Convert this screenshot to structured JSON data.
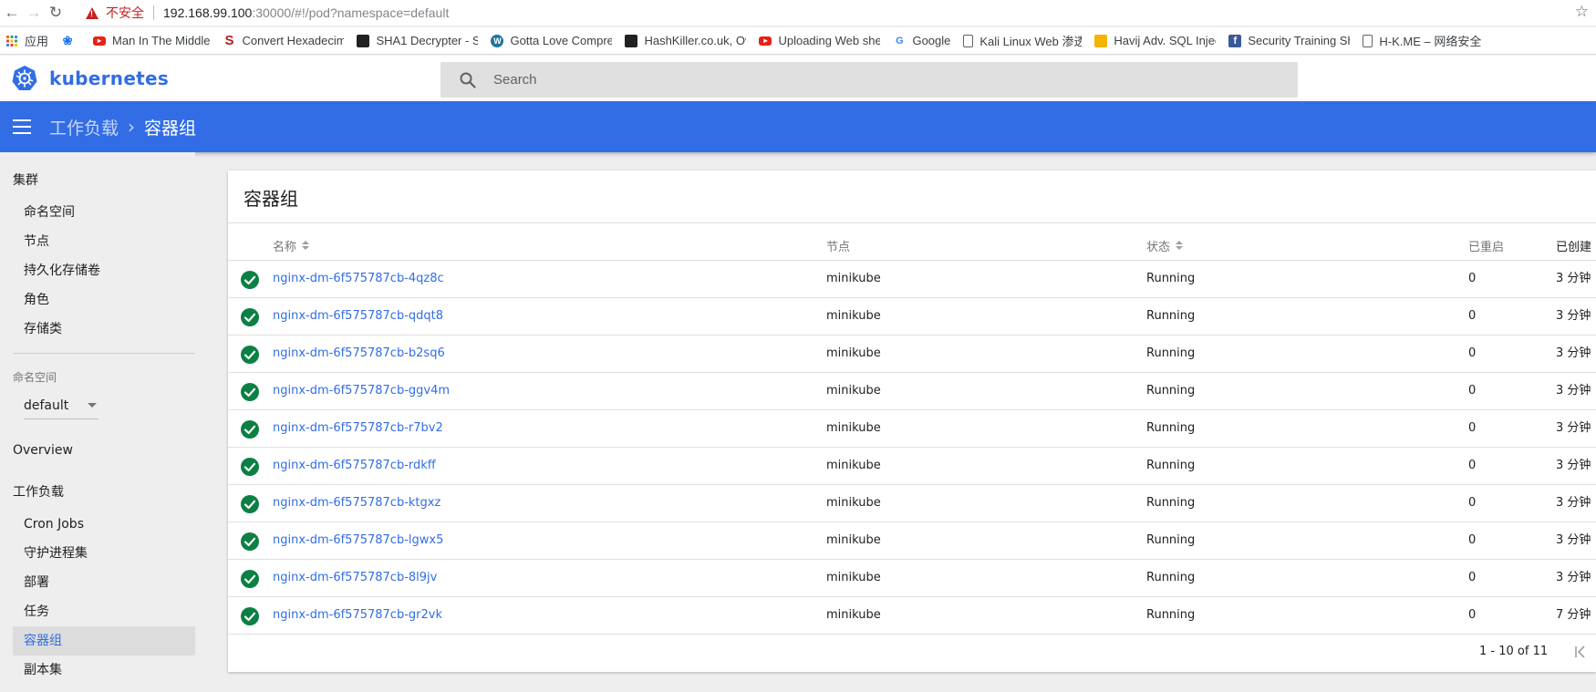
{
  "browser": {
    "insecure_label": "不安全",
    "url_host": "192.168.99.100",
    "url_rest": ":30000/#!/pod?namespace=default",
    "bookmarks": [
      {
        "label": "应用",
        "icon": "apps-grid-icon",
        "color": "#4285f4"
      },
      {
        "label": "",
        "icon": "paw-icon",
        "color": "#1a73e8"
      },
      {
        "label": "Man In The Middle",
        "icon": "youtube-icon",
        "color": "#e62117"
      },
      {
        "label": "Convert Hexadecim",
        "icon": "s-logo-icon",
        "color": "#b71c1c"
      },
      {
        "label": "SHA1 Decrypter - S",
        "icon": "bookmark-site-icon",
        "color": "#212121"
      },
      {
        "label": "Gotta Love Compre",
        "icon": "wordpress-icon",
        "color": "#21759b"
      },
      {
        "label": "HashKiller.co.uk, Ov",
        "icon": "bookmark-site-icon",
        "color": "#212121"
      },
      {
        "label": "Uploading Web she",
        "icon": "youtube-icon",
        "color": "#e62117"
      },
      {
        "label": "Google",
        "icon": "google-icon",
        "color": "#4285f4"
      },
      {
        "label": "Kali Linux Web 渗透",
        "icon": "page-icon",
        "color": "#5f6368"
      },
      {
        "label": "Havij Adv. SQL Injec",
        "icon": "havij-icon",
        "color": "#f4b400"
      },
      {
        "label": "Security Training Sh",
        "icon": "facebook-icon",
        "color": "#3b5998"
      },
      {
        "label": "H-K.ME – 网络安全氵",
        "icon": "page-icon",
        "color": "#5f6368"
      }
    ]
  },
  "app": {
    "brand": "kubernetes",
    "brand_color": "#326de6",
    "search_placeholder": "Search"
  },
  "breadcrumb": {
    "parent": "工作负载",
    "current": "容器组"
  },
  "sidebar": {
    "cluster_heading": "集群",
    "cluster_items": [
      "命名空间",
      "节点",
      "持久化存储卷",
      "角色",
      "存储类"
    ],
    "namespace_label": "命名空间",
    "namespace_value": "default",
    "overview": "Overview",
    "workloads_heading": "工作负载",
    "workload_items": [
      "Cron Jobs",
      "守护进程集",
      "部署",
      "任务",
      "容器组",
      "副本集"
    ],
    "active_item": "容器组"
  },
  "pods": {
    "title": "容器组",
    "columns": {
      "name": "名称",
      "node": "节点",
      "status": "状态",
      "restarts": "已重启",
      "age": "已创建"
    },
    "rows": [
      {
        "name": "nginx-dm-6f575787cb-4qz8c",
        "node": "minikube",
        "status": "Running",
        "restarts": "0",
        "age": "3 分钟"
      },
      {
        "name": "nginx-dm-6f575787cb-qdqt8",
        "node": "minikube",
        "status": "Running",
        "restarts": "0",
        "age": "3 分钟"
      },
      {
        "name": "nginx-dm-6f575787cb-b2sq6",
        "node": "minikube",
        "status": "Running",
        "restarts": "0",
        "age": "3 分钟"
      },
      {
        "name": "nginx-dm-6f575787cb-ggv4m",
        "node": "minikube",
        "status": "Running",
        "restarts": "0",
        "age": "3 分钟"
      },
      {
        "name": "nginx-dm-6f575787cb-r7bv2",
        "node": "minikube",
        "status": "Running",
        "restarts": "0",
        "age": "3 分钟"
      },
      {
        "name": "nginx-dm-6f575787cb-rdkff",
        "node": "minikube",
        "status": "Running",
        "restarts": "0",
        "age": "3 分钟"
      },
      {
        "name": "nginx-dm-6f575787cb-ktgxz",
        "node": "minikube",
        "status": "Running",
        "restarts": "0",
        "age": "3 分钟"
      },
      {
        "name": "nginx-dm-6f575787cb-lgwx5",
        "node": "minikube",
        "status": "Running",
        "restarts": "0",
        "age": "3 分钟"
      },
      {
        "name": "nginx-dm-6f575787cb-8l9jv",
        "node": "minikube",
        "status": "Running",
        "restarts": "0",
        "age": "3 分钟"
      },
      {
        "name": "nginx-dm-6f575787cb-gr2vk",
        "node": "minikube",
        "status": "Running",
        "restarts": "0",
        "age": "7 分钟"
      }
    ],
    "pagination": "1 - 10 of 11",
    "status_ok_color": "#0b8043"
  }
}
